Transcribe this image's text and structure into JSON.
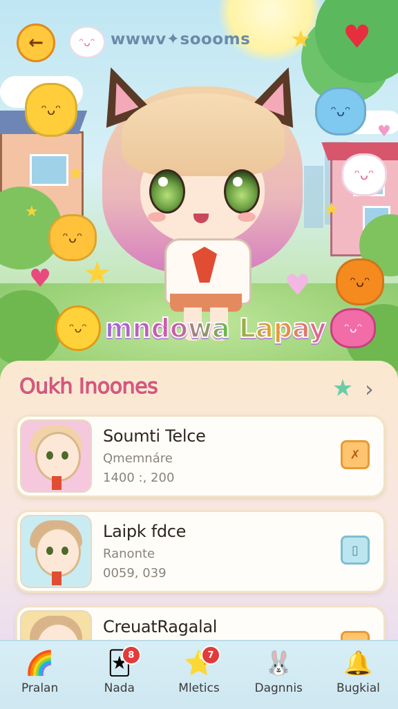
{
  "header": {
    "back_icon": "arrow-left-icon",
    "title": "wwwv✦soooms"
  },
  "hero": {
    "logo_text": "mndowa Lapay"
  },
  "panel": {
    "title": "Oukh Inoones",
    "chevron": "›",
    "star": "★"
  },
  "cards": [
    {
      "title": "Soumti Telce",
      "subtitle": "Qmemnáre",
      "value": "1400 :, 200",
      "button_glyph": "✗",
      "button_style": "orange"
    },
    {
      "title": "Laipk fdce",
      "subtitle": "Ranonte",
      "value": "0059, 039",
      "button_glyph": "▯",
      "button_style": "blue"
    },
    {
      "title": "CreuatRagalal",
      "subtitle": "",
      "value": "",
      "button_glyph": "",
      "button_style": "orange"
    }
  ],
  "nav": [
    {
      "label": "Pralan",
      "icon": "rainbow-icon",
      "glyph": "🌈",
      "badge": ""
    },
    {
      "label": "Nada",
      "icon": "card-icon",
      "glyph": "🃏",
      "badge": "8"
    },
    {
      "label": "Mletics",
      "icon": "blue-star-icon",
      "glyph": "⭐",
      "badge": "7"
    },
    {
      "label": "Dagnnis",
      "icon": "bunny-icon",
      "glyph": "🐰",
      "badge": ""
    },
    {
      "label": "Bugkial",
      "icon": "bell-icon",
      "glyph": "🔔",
      "badge": ""
    }
  ],
  "colors": {
    "accent": "#e25b86",
    "back_button": "#ffc83d",
    "nav_bg": "#d7eef6"
  }
}
